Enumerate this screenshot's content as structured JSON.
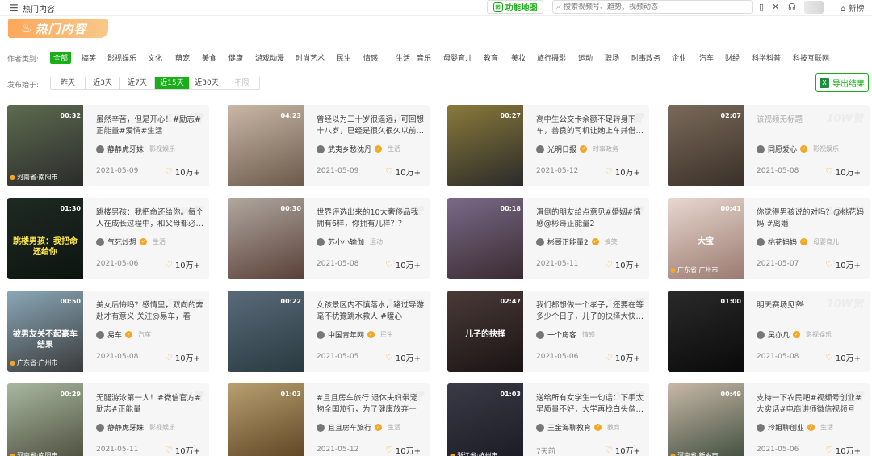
{
  "header": {
    "page_title": "热门内容",
    "feature_button": "功能地图",
    "search_placeholder": "搜索视频号、趋势、视频动态",
    "new_list": "新榜"
  },
  "banner": {
    "title": "热门内容"
  },
  "filters": {
    "category_label": "作者类别:",
    "categories": [
      {
        "label": "全部",
        "active": true
      },
      {
        "label": "搞笑"
      },
      {
        "label": "影视娱乐"
      },
      {
        "label": "文化"
      },
      {
        "label": "萌宠"
      },
      {
        "label": "美食"
      },
      {
        "label": "健康"
      },
      {
        "label": "游戏动漫"
      },
      {
        "label": "时尚艺术"
      },
      {
        "label": "民生"
      },
      {
        "label": "情感"
      },
      {
        "label": "生活"
      },
      {
        "label": "音乐"
      },
      {
        "label": "母婴育儿"
      },
      {
        "label": "教育"
      },
      {
        "label": "美妆"
      },
      {
        "label": "旅行摄影"
      },
      {
        "label": "运动"
      },
      {
        "label": "职场"
      },
      {
        "label": "时事政务"
      },
      {
        "label": "企业"
      },
      {
        "label": "汽车"
      },
      {
        "label": "财经"
      },
      {
        "label": "科学科普"
      },
      {
        "label": "科技互联网"
      }
    ],
    "date_label": "发布始于:",
    "dates": [
      {
        "label": "昨天"
      },
      {
        "label": "近3天"
      },
      {
        "label": "近7天"
      },
      {
        "label": "近15天",
        "active": true
      },
      {
        "label": "近30天"
      },
      {
        "label": "不限",
        "disabled": true
      }
    ],
    "export": "导出结果"
  },
  "cards": [
    {
      "duration": "00:32",
      "location": "河南省·南阳市",
      "desc": "虽然辛苦，但是开心！#励志#正能量#爱情#生活",
      "author": "静静虎牙妹",
      "verified": false,
      "category": "影视娱乐",
      "date": "2021-05-09",
      "likes": "10万+"
    },
    {
      "duration": "04:23",
      "location": "",
      "desc": "曾经以为三十岁很遥远，可回想十八岁，已经是很久很久以前…",
      "author": "武夷乡愁沈丹",
      "verified": true,
      "category": "生活",
      "date": "2021-05-09",
      "likes": "10万+"
    },
    {
      "duration": "00:27",
      "location": "",
      "desc": "高中生公交卡余额不足转身下车，善良的司机让她上车并借…",
      "author": "光明日报",
      "verified": true,
      "category": "时事政务",
      "date": "2021-05-12",
      "likes": "10万+"
    },
    {
      "duration": "02:07",
      "location": "",
      "desc": "该视频无标题",
      "muted": true,
      "author": "同愿爱心",
      "verified": true,
      "category": "影视娱乐",
      "date": "2021-05-08",
      "likes": "10万+"
    },
    {
      "duration": "01:30",
      "location": "",
      "overlay": "跳楼男孩：我把命还给你",
      "desc": "跳楼男孩：我把命还给你。每个人在成长过程中，和父母都必…",
      "author": "气死炒想",
      "verified": true,
      "category": "生活",
      "date": "2021-05-06",
      "likes": "10万+"
    },
    {
      "duration": "00:30",
      "location": "",
      "desc": "世界评选出来的10大奢侈品我拥有6样，你拥有几样？？",
      "author": "苏小小输伽",
      "verified": false,
      "category": "运动",
      "date": "2021-05-08",
      "likes": "10万+"
    },
    {
      "duration": "00:18",
      "location": "",
      "desc": "滑倒的朋友给点意见#婚姻#情感@彬哥正能量2",
      "author": "彬哥正能量2",
      "verified": true,
      "category": "搞笑",
      "date": "2021-05-11",
      "likes": "10万+"
    },
    {
      "duration": "00:41",
      "location": "广东省·广州市",
      "overlay": "大宝",
      "desc": "你觉得男孩说的对吗？@挑花妈妈 #离婚",
      "author": "桃花妈妈",
      "verified": true,
      "category": "母婴育儿",
      "date": "2021-05-07",
      "likes": "10万+"
    },
    {
      "duration": "00:50",
      "location": "广东省·广州市",
      "overlay": "被男友关不起豪车结果",
      "desc": "美女后悔吗？感情里，双向的奔赴才有意义 关注@易车，看潇…",
      "author": "易车",
      "verified": true,
      "category": "汽车",
      "date": "2021-05-08",
      "likes": "10万+"
    },
    {
      "duration": "00:22",
      "location": "",
      "desc": "女孩景区内不慎落水，路过导游毫不犹豫跳水救人 #暖心",
      "author": "中国青年网",
      "verified": true,
      "category": "民生",
      "date": "2021-05-05",
      "likes": "10万+"
    },
    {
      "duration": "02:47",
      "location": "",
      "overlay": "儿子的抉择",
      "desc": "我们都想做一个孝子，还要在等多少个日子，儿子的抉择大快…",
      "author": "一个房客",
      "verified": false,
      "category": "情感",
      "date": "2021-05-06",
      "likes": "10万+"
    },
    {
      "duration": "01:00",
      "location": "",
      "desc": "明天赛场见🏁",
      "author": "吴亦凡",
      "verified": true,
      "category": "影视娱乐",
      "date": "2021-05-08",
      "likes": "10万+"
    },
    {
      "duration": "00:29",
      "location": "河南省·南阳市",
      "desc": "无腿游泳第一人！#微信官方#励志#正能量",
      "author": "静静虎牙妹",
      "verified": false,
      "category": "影视娱乐",
      "date": "2021-05-11",
      "likes": "10万+"
    },
    {
      "duration": "01:03",
      "location": "",
      "desc": "#且且房车旅行 退休夫妇带宠物全国旅行，为了健康放弃一切…",
      "author": "且且房车旅行",
      "verified": true,
      "category": "生活",
      "date": "2021-05-12",
      "likes": "10万+"
    },
    {
      "duration": "01:03",
      "location": "浙江省·杭州市",
      "desc": "送给所有女学生一句话：下手太早质量不好，大学再找白头偕…",
      "author": "王金海聊教育",
      "verified": true,
      "category": "教育",
      "date": "7天前",
      "likes": "10万+"
    },
    {
      "duration": "00:49",
      "location": "河南省·新乡市",
      "desc": "支持一下农民吧#视频号创业#大实话#电商讲师微信视频号创…",
      "author": "玲姐聊创业",
      "verified": true,
      "category": "生活",
      "date": "2021-05-06",
      "likes": "10万+"
    }
  ]
}
